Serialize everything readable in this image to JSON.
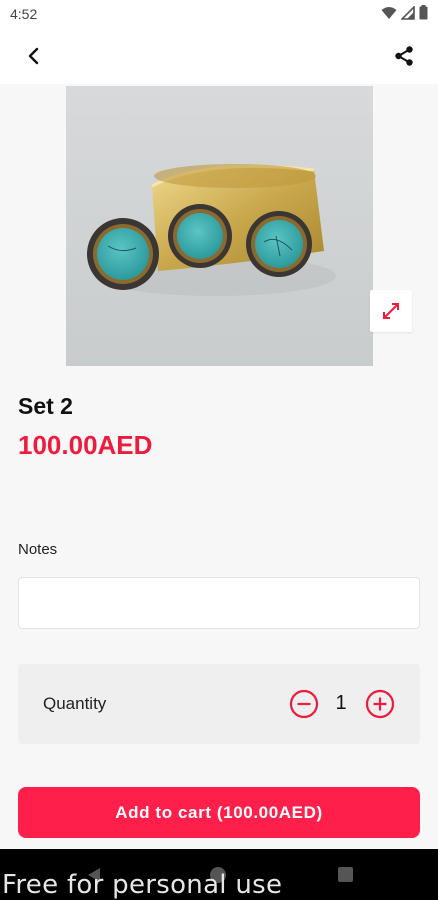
{
  "status_bar": {
    "time": "4:52"
  },
  "product": {
    "title": "Set 2",
    "price": "100.00AED"
  },
  "notes": {
    "label": "Notes",
    "value": ""
  },
  "quantity": {
    "label": "Quantity",
    "value": "1"
  },
  "cart": {
    "button_label": "Add to cart (100.00AED)"
  },
  "watermark": "Free for personal use",
  "icons": {
    "back": "arrow-back-icon",
    "share": "share-icon",
    "expand": "expand-icon",
    "minus": "minus-circle-icon",
    "plus": "plus-circle-icon"
  },
  "colors": {
    "accent": "#fe1f4a",
    "price": "#ef1b3d"
  }
}
